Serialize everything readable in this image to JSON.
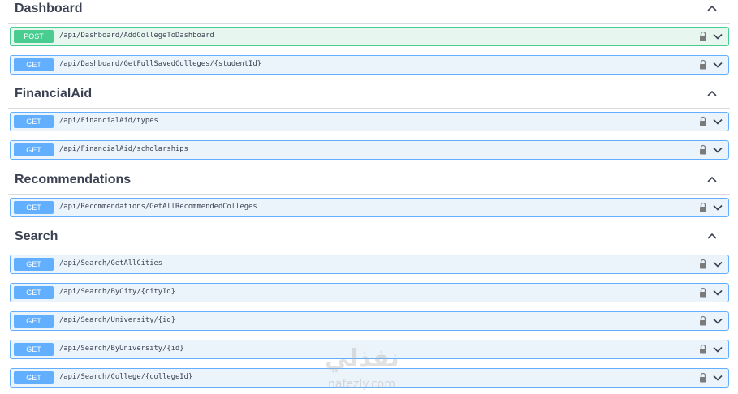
{
  "sections": [
    {
      "title": "Dashboard",
      "operations": [
        {
          "method": "POST",
          "path": "/api/Dashboard/AddCollegeToDashboard"
        },
        {
          "method": "GET",
          "path": "/api/Dashboard/GetFullSavedColleges/{studentId}"
        }
      ]
    },
    {
      "title": "FinancialAid",
      "operations": [
        {
          "method": "GET",
          "path": "/api/FinancialAid/types"
        },
        {
          "method": "GET",
          "path": "/api/FinancialAid/scholarships"
        }
      ]
    },
    {
      "title": "Recommendations",
      "operations": [
        {
          "method": "GET",
          "path": "/api/Recommendations/GetAllRecommendedColleges"
        }
      ]
    },
    {
      "title": "Search",
      "operations": [
        {
          "method": "GET",
          "path": "/api/Search/GetAllCities"
        },
        {
          "method": "GET",
          "path": "/api/Search/ByCity/{cityId}"
        },
        {
          "method": "GET",
          "path": "/api/Search/University/{id}"
        },
        {
          "method": "GET",
          "path": "/api/Search/ByUniversity/{id}"
        },
        {
          "method": "GET",
          "path": "/api/Search/College/{collegeId}"
        }
      ]
    }
  ],
  "watermark": {
    "arabic": "نفذلي",
    "latin": "nafezly.com"
  },
  "colors": {
    "get": "#61affe",
    "get_bg": "#ebf3fb",
    "post": "#49cc90",
    "post_bg": "#e8f6f0",
    "text": "#3b4151"
  },
  "icons": {
    "section_toggle": "chevron-up-icon",
    "operation_lock": "lock-icon",
    "operation_expand": "chevron-down-icon"
  }
}
